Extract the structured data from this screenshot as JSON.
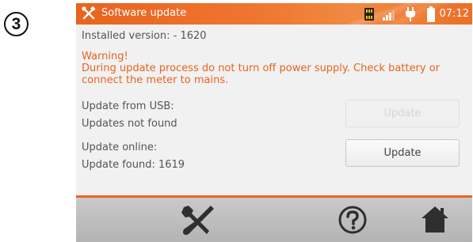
{
  "step_badge": "3",
  "header": {
    "title": "Software update",
    "clock": "07:12",
    "background_color": "#e8641f",
    "icons": [
      "tools-icon",
      "memory-card-icon",
      "signal-bars-icon",
      "power-plug-icon",
      "battery-icon"
    ]
  },
  "content": {
    "installed_version": "Installed version: - 1620",
    "warning_title": "Warning!",
    "warning_line1": "During update process do not turn off power supply. Check battery or",
    "warning_line2": "connect the meter to mains.",
    "usb_label": "Update from USB:",
    "usb_status": "Updates not found",
    "usb_button": "Update",
    "online_label": "Update online:",
    "online_status": "Update found: 1619",
    "online_button": "Update",
    "warning_color": "#e8641f"
  },
  "bottom_bar": {
    "icons": [
      "tools-icon",
      "help-icon",
      "home-icon"
    ]
  }
}
